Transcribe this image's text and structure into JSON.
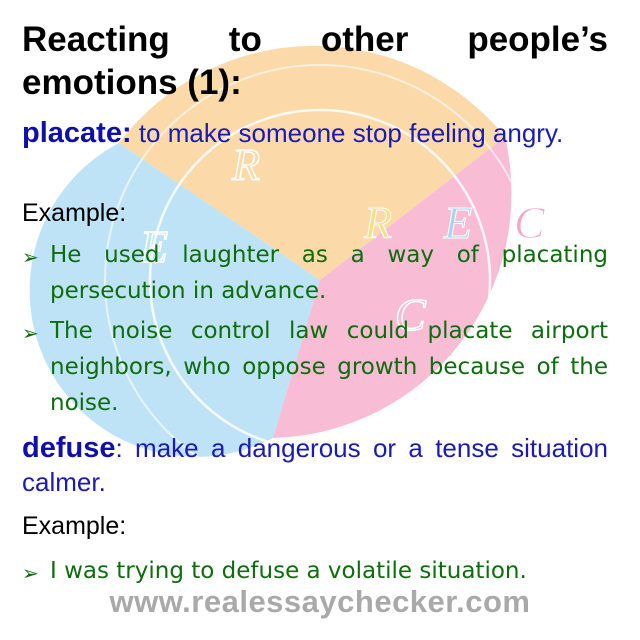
{
  "title": "Reacting to other people’s emotions (1):",
  "entries": [
    {
      "term": "placate:",
      "definition": " to make someone stop feeling angry.",
      "example_label": "Example:",
      "examples": [
        "He used laughter as a way of placating persecution in advance.",
        "The noise control law could placate airport neighbors, who oppose growth because of the noise."
      ]
    },
    {
      "term": "defuse",
      "definition": ": make a dangerous or a tense situation calmer.",
      "example_label": "Example:",
      "examples": [
        "I was trying to defuse a volatile situation."
      ]
    }
  ],
  "bullet_glyph": "➢",
  "watermark": {
    "letters": [
      "R",
      "E",
      "C"
    ]
  },
  "website": "www.realessaychecker.com",
  "colors": {
    "title": "#000000",
    "term": "#1010a8",
    "definition": "#1b1bb3",
    "example_text": "#0d6d0d",
    "website": "#a9a9a9",
    "wm_orange": "#fbd9a9",
    "wm_blue": "#bfe3f6",
    "wm_pink": "#f8bcd4"
  }
}
